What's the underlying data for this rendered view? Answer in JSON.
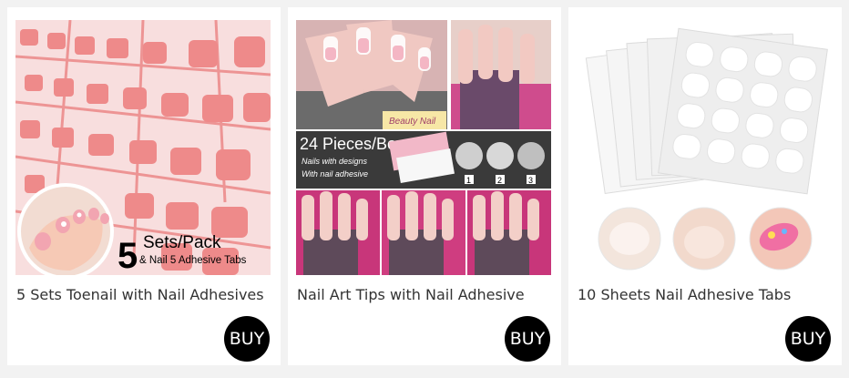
{
  "products": [
    {
      "title": "5 Sets Toenail with Nail Adhesives",
      "buy_label": "BUY",
      "image": {
        "big_text": "5",
        "line1": "Sets/Pack",
        "line2": "& Nail 5 Adhesive Tabs"
      }
    },
    {
      "title": "Nail Art Tips with Nail Adhesive",
      "buy_label": "BUY",
      "image": {
        "banner_title": "24 Pieces/Box",
        "banner_line1": "Nails with designs",
        "banner_line2": "With nail adhesive",
        "brand_label": "Beauty Nail",
        "steps": [
          "1",
          "2",
          "3"
        ]
      }
    },
    {
      "title": "10 Sheets Nail Adhesive Tabs",
      "buy_label": "BUY"
    }
  ],
  "colors": {
    "nail_pink": "#ee8a8a",
    "buy_button": "#000000",
    "banner_dark": "#3a3a3a",
    "magenta": "#c9437f"
  }
}
